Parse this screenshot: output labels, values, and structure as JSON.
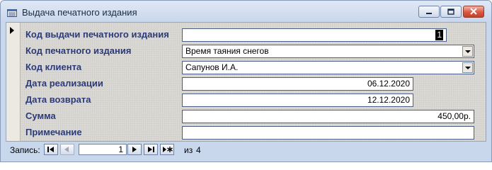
{
  "window": {
    "title": "Выдача печатного издания"
  },
  "form": {
    "fields": [
      {
        "label": "Код выдачи печатного издания",
        "value": "1",
        "type": "number"
      },
      {
        "label": "Код печатного издания",
        "value": "Время таяния снегов",
        "type": "combo"
      },
      {
        "label": "Код клиента",
        "value": "Сапунов И.А.",
        "type": "combo"
      },
      {
        "label": "Дата реализации",
        "value": "06.12.2020",
        "type": "date"
      },
      {
        "label": "Дата возврата",
        "value": "12.12.2020",
        "type": "date"
      },
      {
        "label": "Сумма",
        "value": "450,00р.",
        "type": "currency"
      },
      {
        "label": "Примечание",
        "value": "",
        "type": "text"
      }
    ]
  },
  "navigation": {
    "record_label": "Запись:",
    "current_record": "1",
    "of_label": "из",
    "total_records": "4"
  },
  "icons": {
    "app": "form-icon",
    "minimize": "minimize-icon",
    "restore": "restore-icon",
    "close": "close-icon",
    "first": "first-record-icon",
    "prev": "previous-record-icon",
    "next": "next-record-icon",
    "last": "last-record-icon",
    "new": "new-record-icon"
  }
}
